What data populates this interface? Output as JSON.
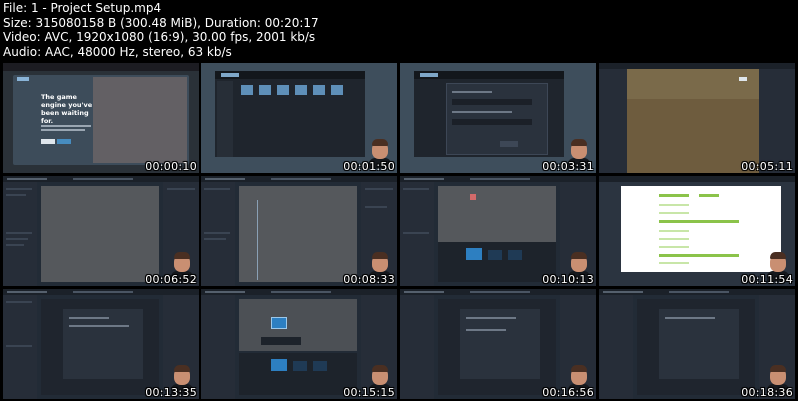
{
  "info": {
    "file": "File: 1 - Project Setup.mp4",
    "size": "Size: 315080158 B (300.48 MiB), Duration: 00:20:17",
    "video": "Video: AVC, 1920x1080 (16:9), 30.00 fps, 2001 kb/s",
    "audio": "Audio: AAC, 48000 Hz, stereo, 63 kb/s"
  },
  "thumbnails": [
    {
      "time": "00:00:10",
      "headline": "The game engine you've been waiting for."
    },
    {
      "time": "00:01:50"
    },
    {
      "time": "00:03:31"
    },
    {
      "time": "00:05:11"
    },
    {
      "time": "00:06:52"
    },
    {
      "time": "00:08:33"
    },
    {
      "time": "00:10:13"
    },
    {
      "time": "00:11:54"
    },
    {
      "time": "00:13:35"
    },
    {
      "time": "00:15:15"
    },
    {
      "time": "00:16:56"
    },
    {
      "time": "00:18:36"
    }
  ],
  "colors": {
    "background": "#000000",
    "text": "#ffffff",
    "editor_dark": "#262d38",
    "accent_blue": "#478cbf",
    "spreadsheet_green": "#8bc34a"
  }
}
